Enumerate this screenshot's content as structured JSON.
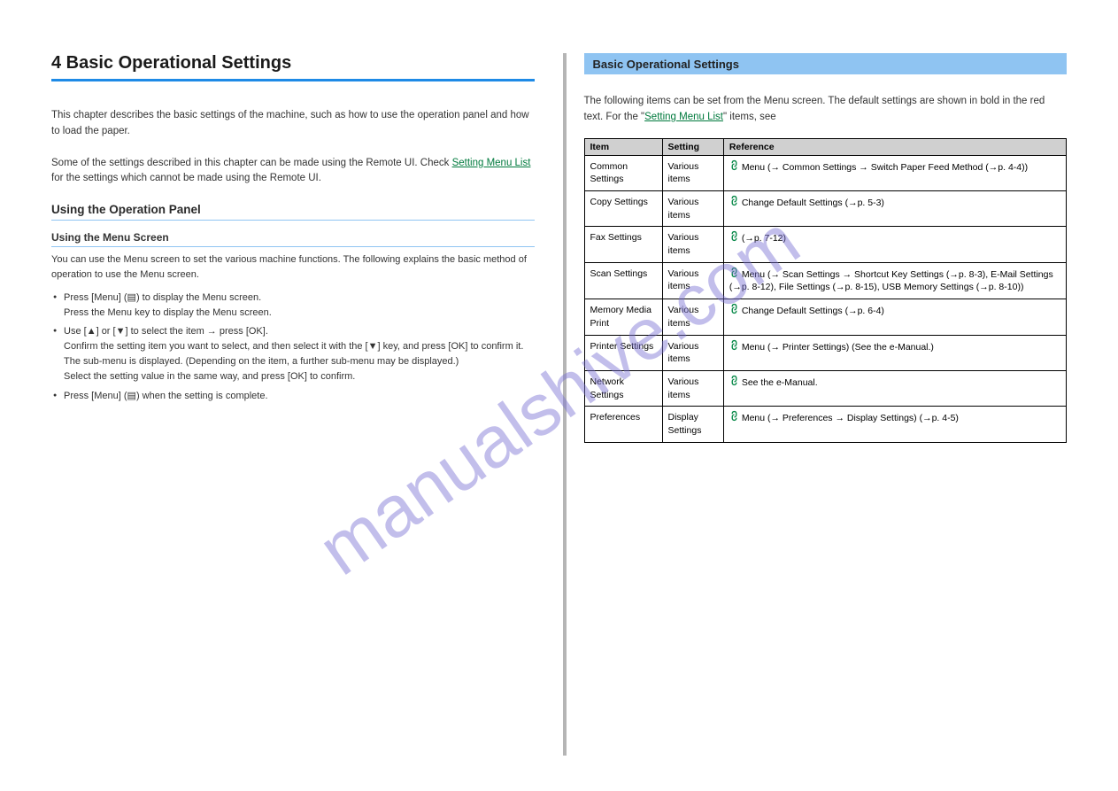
{
  "watermark": "manualshive.com",
  "left": {
    "chapter_title": "4 Basic Operational Settings",
    "intro_1": "This chapter describes the basic settings of the machine, such as how to use the operation panel and how to load the paper.",
    "intro_2_a": "Some of the settings described in this chapter can be made using the Remote UI. Check ",
    "intro_2_link": "Setting Menu List",
    "intro_2_b": " for the settings which cannot be made using the Remote UI.",
    "heading_using_panel": "Using the Operation Panel",
    "sub_menu": "Using the Menu Screen",
    "menu_body": "You can use the Menu screen to set the various machine functions. The following explains the basic method of operation to use the Menu screen.",
    "b1_a": "Press [Menu] (",
    "b1_b": ") to display the Menu screen.",
    "b1_c": "Press the Menu key to display the Menu screen.",
    "b2_a": "Use [",
    "b2_b": "] or [",
    "b2_c": "] to select the item → press [OK].",
    "b2_d": "Confirm the setting item you want to select, and then select it with the [",
    "b2_e": "] key, and press [OK] to confirm it.",
    "b2_f": "The sub-menu is displayed. (Depending on the item, a further sub-menu may be displayed.)",
    "b2_g": "Select the setting value in the same way, and press [OK] to confirm.",
    "b3_a": "Press [Menu] (",
    "b3_b": ") when the setting is complete."
  },
  "right": {
    "header": "Basic Operational Settings",
    "intro_a": "The following items can be set from the Menu screen. The default settings are shown in bold in the red text. For the \"",
    "intro_link": "Setting Menu List",
    "intro_b": "\" items, see ",
    "table": {
      "headers": [
        "Item",
        "Setting",
        "Reference"
      ],
      "rows": [
        {
          "item": "Common Settings",
          "setting": "Various items",
          "ref": "Menu (→ Common Settings → Switch Paper Feed Method (→p. 4-4))"
        },
        {
          "item": "Copy Settings",
          "setting": "Various items",
          "ref": "Change Default Settings (→p. 5-3)"
        },
        {
          "item": "Fax Settings",
          "setting": "Various items",
          "ref": "(→p. 7-12)"
        },
        {
          "item": "Scan Settings",
          "setting": "Various items",
          "ref": "Menu (→ Scan Settings → Shortcut Key Settings (→p. 8-3), E-Mail Settings (→p. 8-12), File Settings (→p. 8-15), USB Memory Settings (→p. 8-10))"
        },
        {
          "item": "Memory Media Print",
          "setting": "Various items",
          "ref": "Change Default Settings (→p. 6-4)"
        },
        {
          "item": "Printer Settings",
          "setting": "Various items",
          "ref": "Menu (→ Printer Settings) (See the e-Manual.)"
        },
        {
          "item": "Network Settings",
          "setting": "Various items",
          "ref": "See the e-Manual."
        },
        {
          "item": "Preferences",
          "setting": "Display Settings",
          "ref": "Menu (→ Preferences → Display Settings) (→p. 4-5)"
        }
      ]
    }
  }
}
